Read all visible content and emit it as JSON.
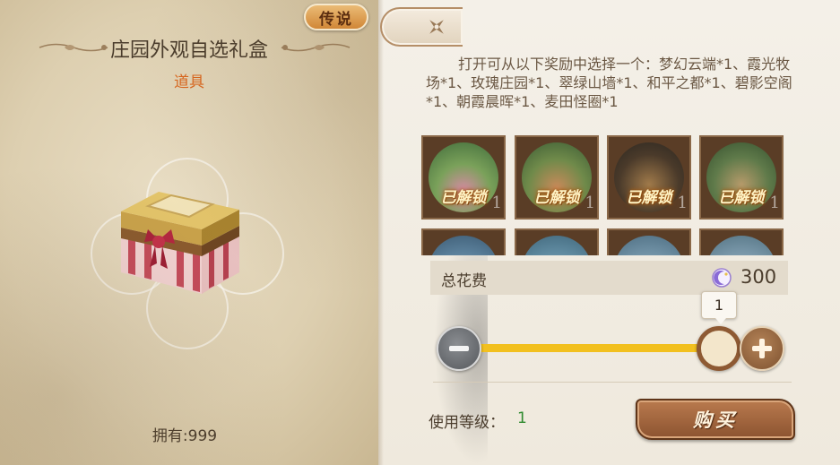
{
  "item": {
    "rarity": "传说",
    "name": "庄园外观自选礼盒",
    "type": "道具",
    "owned": "拥有:999"
  },
  "description": "打开可从以下奖励中选择一个：梦幻云端*1、霞光牧场*1、玫瑰庄园*1、翠绿山墙*1、和平之都*1、碧影空阁*1、朝霞晨晖*1、麦田怪圈*1",
  "rewards": [
    {
      "status": "已解锁",
      "qty": "1"
    },
    {
      "status": "已解锁",
      "qty": "1"
    },
    {
      "status": "已解锁",
      "qty": "1"
    },
    {
      "status": "已解锁",
      "qty": "1"
    },
    {
      "status": "",
      "qty": ""
    },
    {
      "status": "",
      "qty": ""
    },
    {
      "status": "",
      "qty": ""
    },
    {
      "status": "",
      "qty": ""
    }
  ],
  "cost": {
    "label": "总花费",
    "value": "300",
    "currency_icon": "moon-gem-icon"
  },
  "quantity": {
    "value": "1",
    "slider_fraction": 1.0
  },
  "level": {
    "label": "使用等级：",
    "value": "1"
  },
  "buy_label": "购买",
  "colors": {
    "rarity_badge": "#d98a36",
    "item_type": "#d9661e",
    "level_value": "#2e8a2e",
    "slider": "#f2c01e",
    "buy_button": "#a4683f"
  }
}
